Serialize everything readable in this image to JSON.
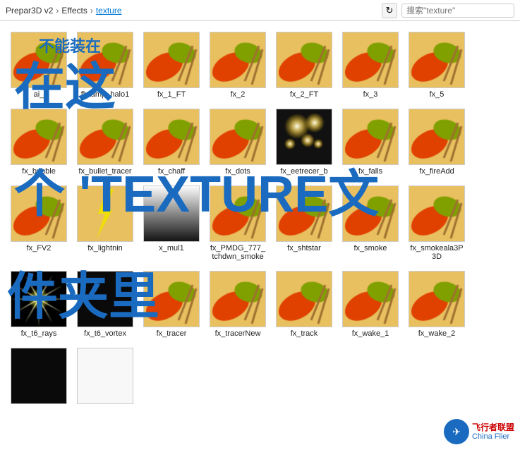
{
  "header": {
    "breadcrumb": [
      "Prepar3D v2",
      "Effects",
      "texture"
    ],
    "refresh_icon": "↻",
    "search_placeholder": "搜索\"texture\""
  },
  "overlay": {
    "line1": "不能装在",
    "line2": "在这",
    "line3": "个 'TEXTURE文",
    "line4": "件夹里"
  },
  "files": [
    {
      "name": "ai_",
      "thumb_type": "paint"
    },
    {
      "name": "flytamp_halo1",
      "thumb_type": "paint"
    },
    {
      "name": "fx_1_FT",
      "thumb_type": "paint"
    },
    {
      "name": "fx_2",
      "thumb_type": "paint"
    },
    {
      "name": "fx_2_FT",
      "thumb_type": "paint"
    },
    {
      "name": "fx_3",
      "thumb_type": "paint"
    },
    {
      "name": "fx_5",
      "thumb_type": "paint"
    },
    {
      "name": "fx_bubble",
      "thumb_type": "paint"
    },
    {
      "name": "fx_bullet_tracer",
      "thumb_type": "paint"
    },
    {
      "name": "fx_chaff",
      "thumb_type": "paint"
    },
    {
      "name": "fx_dots",
      "thumb_type": "paint"
    },
    {
      "name": "fx_eetrecer_b",
      "thumb_type": "glow"
    },
    {
      "name": "fx_falls",
      "thumb_type": "paint"
    },
    {
      "name": "fx_fireAdd",
      "thumb_type": "paint"
    },
    {
      "name": "fx_FV2",
      "thumb_type": "paint"
    },
    {
      "name": "fx_lightnin",
      "thumb_type": "lightning"
    },
    {
      "name": "x_mul1",
      "thumb_type": "gradient"
    },
    {
      "name": "fx_PMDG_777_tchdwn_smoke",
      "thumb_type": "paint"
    },
    {
      "name": "fx_shtstar",
      "thumb_type": "paint"
    },
    {
      "name": "fx_smoke",
      "thumb_type": "paint"
    },
    {
      "name": "fx_smokeala3P3D",
      "thumb_type": "paint"
    },
    {
      "name": "fx_t6_rays",
      "thumb_type": "rays"
    },
    {
      "name": "fx_t6_vortex",
      "thumb_type": "dark"
    },
    {
      "name": "fx_tracer",
      "thumb_type": "paint"
    },
    {
      "name": "fx_tracerNew",
      "thumb_type": "paint"
    },
    {
      "name": "fx_track",
      "thumb_type": "paint"
    },
    {
      "name": "fx_wake_1",
      "thumb_type": "paint"
    },
    {
      "name": "fx_wake_2",
      "thumb_type": "paint"
    },
    {
      "name": "",
      "thumb_type": "dark"
    },
    {
      "name": "",
      "thumb_type": "white"
    }
  ],
  "watermark": {
    "logo_symbol": "✈",
    "line1": "飞行者联盟",
    "line2": "China Flier"
  }
}
